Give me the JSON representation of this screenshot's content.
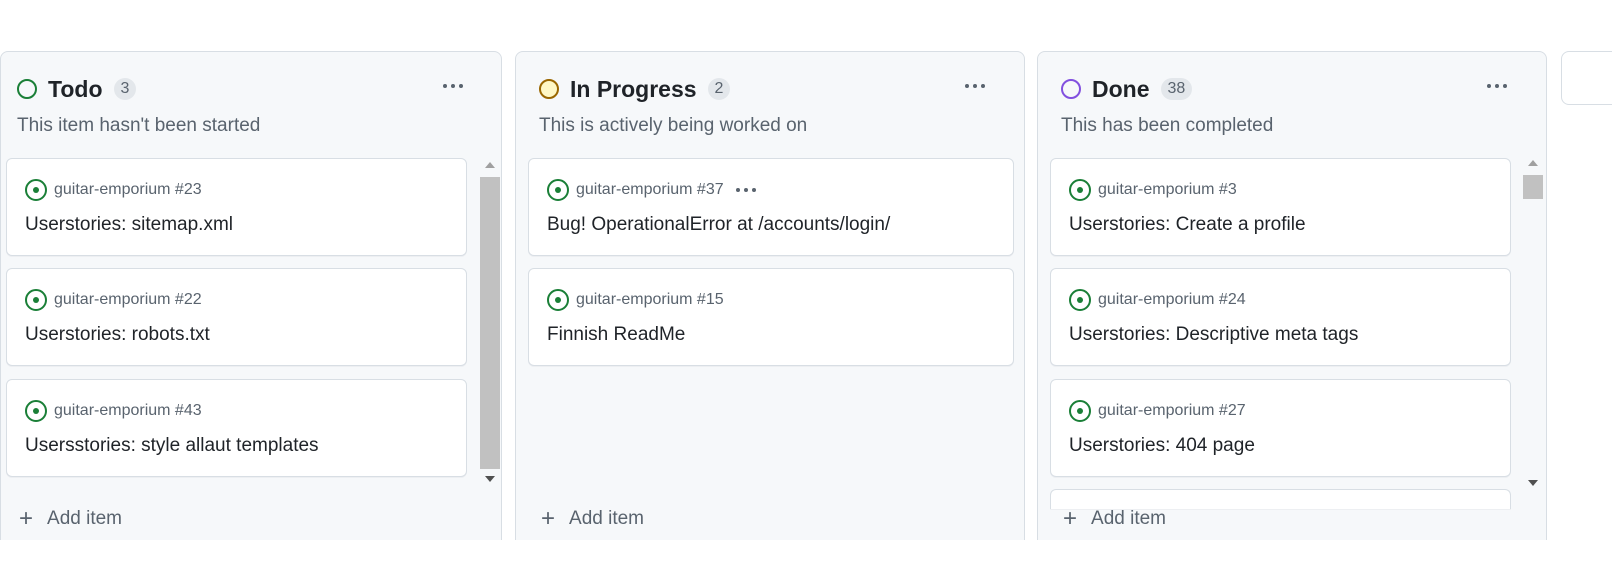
{
  "columns": [
    {
      "title": "Todo",
      "count": "3",
      "description": "This item hasn't been started",
      "status_color": "#1a7f37",
      "add_label": "Add item",
      "cards": [
        {
          "repo": "guitar-emporium #23",
          "title": "Userstories: sitemap.xml"
        },
        {
          "repo": "guitar-emporium #22",
          "title": "Userstories: robots.txt"
        },
        {
          "repo": "guitar-emporium #43",
          "title": "Usersstories: style allaut templates"
        }
      ]
    },
    {
      "title": "In Progress",
      "count": "2",
      "description": "This is actively being worked on",
      "status_color": "#9a6700",
      "status_fill": "#fff8c5",
      "add_label": "Add item",
      "cards": [
        {
          "repo": "guitar-emporium #37",
          "title": "Bug! OperationalError at /accounts/login/"
        },
        {
          "repo": "guitar-emporium #15",
          "title": "Finnish ReadMe"
        }
      ]
    },
    {
      "title": "Done",
      "count": "38",
      "description": "This has been completed",
      "status_color": "#8250df",
      "add_label": "Add item",
      "cards": [
        {
          "repo": "guitar-emporium #3",
          "title": "Userstories: Create a profile"
        },
        {
          "repo": "guitar-emporium #24",
          "title": "Userstories: Descriptive meta tags"
        },
        {
          "repo": "guitar-emporium #27",
          "title": "Userstories: 404 page"
        }
      ]
    }
  ],
  "icons": {
    "status": "circle-status-icon",
    "issue": "issue-opened-icon",
    "menu": "kebab-horizontal-icon",
    "add": "plus-icon"
  }
}
